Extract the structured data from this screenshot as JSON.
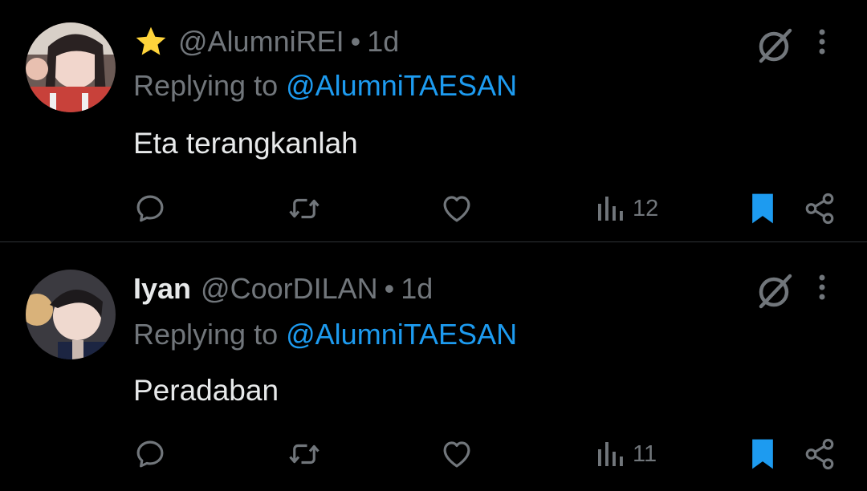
{
  "tweets": [
    {
      "display_name": "",
      "badge_icon": "star-icon",
      "handle": "@AlumniREI",
      "separator": "•",
      "time": "1d",
      "replying_prefix": "Replying to",
      "replying_to": "@AlumniTAESAN",
      "text": "Eta terangkanlah",
      "views": "12"
    },
    {
      "display_name": "Iyan",
      "handle": "@CoorDILAN",
      "separator": "•",
      "time": "1d",
      "replying_prefix": "Replying to",
      "replying_to": "@AlumniTAESAN",
      "text": "Peradaban",
      "views": "11"
    }
  ],
  "colors": {
    "background": "#000000",
    "text": "#e7e9ea",
    "muted": "#71767b",
    "accent": "#1d9bf0",
    "divider": "#2f3336",
    "star": "#ffd43b"
  }
}
